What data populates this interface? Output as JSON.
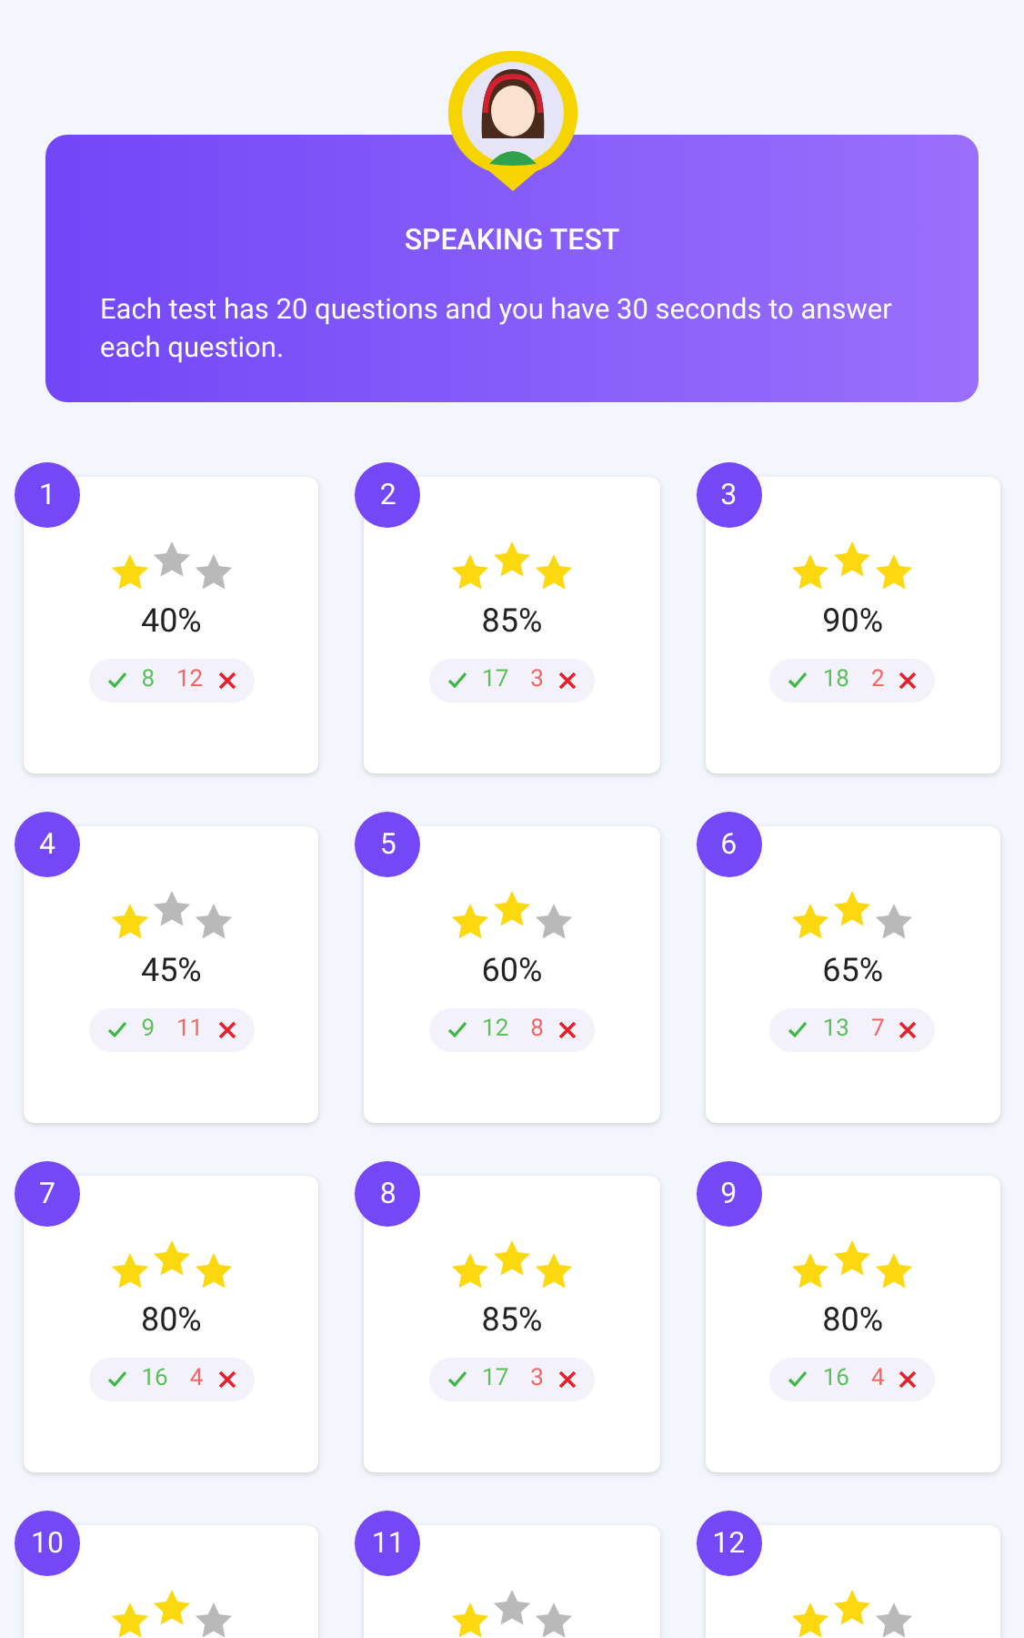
{
  "header": {
    "title": "SPEAKING TEST",
    "description": "Each test has 20 questions and you have 30 seconds to answer each question."
  },
  "tests": [
    {
      "number": "1",
      "stars": 1,
      "score": "40%",
      "correct": "8",
      "wrong": "12"
    },
    {
      "number": "2",
      "stars": 3,
      "score": "85%",
      "correct": "17",
      "wrong": "3"
    },
    {
      "number": "3",
      "stars": 3,
      "score": "90%",
      "correct": "18",
      "wrong": "2"
    },
    {
      "number": "4",
      "stars": 1,
      "score": "45%",
      "correct": "9",
      "wrong": "11"
    },
    {
      "number": "5",
      "stars": 2,
      "score": "60%",
      "correct": "12",
      "wrong": "8"
    },
    {
      "number": "6",
      "stars": 2,
      "score": "65%",
      "correct": "13",
      "wrong": "7"
    },
    {
      "number": "7",
      "stars": 3,
      "score": "80%",
      "correct": "16",
      "wrong": "4"
    },
    {
      "number": "8",
      "stars": 3,
      "score": "85%",
      "correct": "17",
      "wrong": "3"
    },
    {
      "number": "9",
      "stars": 3,
      "score": "80%",
      "correct": "16",
      "wrong": "4"
    },
    {
      "number": "10",
      "stars": 2
    },
    {
      "number": "11",
      "stars": 1
    },
    {
      "number": "12",
      "stars": 2
    }
  ]
}
